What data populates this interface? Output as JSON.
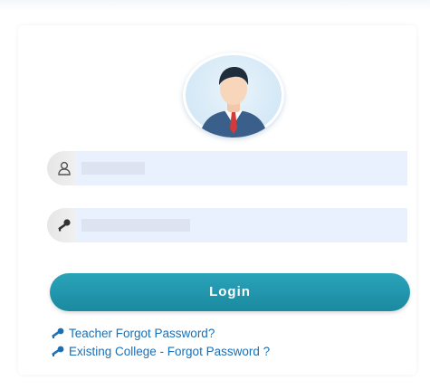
{
  "form": {
    "avatar_icon": "user-avatar-icon",
    "username": {
      "icon": "user-icon",
      "value": "",
      "placeholder": ""
    },
    "password": {
      "icon": "key-icon",
      "value": "",
      "placeholder": ""
    },
    "login_label": "Login"
  },
  "links": {
    "teacher_forgot": "Teacher Forgot Password?",
    "college_forgot": "Existing College - Forgot Password ?",
    "icon": "key-icon"
  },
  "colors": {
    "accent": "#1f97ad",
    "link": "#1a6fb5",
    "input_bg": "#e9f0fe"
  }
}
